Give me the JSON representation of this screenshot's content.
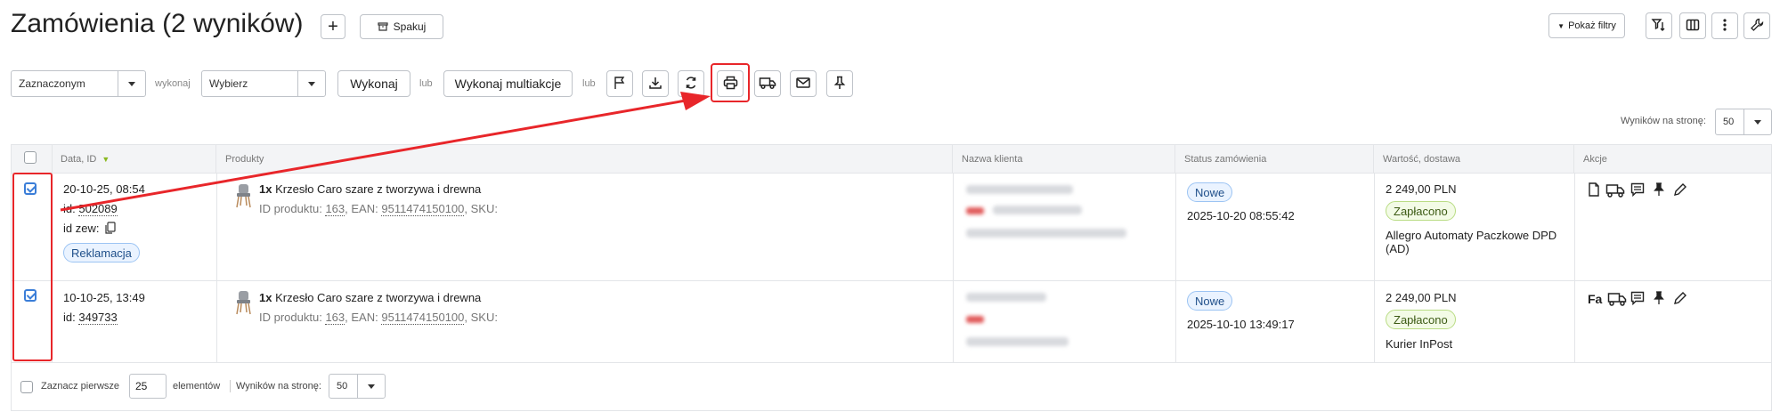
{
  "header": {
    "title": "Zamówienia (2 wyników)",
    "add_label": "+",
    "pack_label": "Spakuj",
    "show_filters_label": "Pokaż filtry"
  },
  "toolbar": {
    "scope_select": "Zaznaczonym",
    "wykonaj_label": "wykonaj",
    "action_select": "Wybierz",
    "execute_label": "Wykonaj",
    "lub1": "lub",
    "multiaction_label": "Wykonaj multiakcje",
    "lub2": "lub"
  },
  "per_page_top": {
    "label": "Wyników na stronę:",
    "value": "50"
  },
  "table": {
    "headers": [
      "Data, ID",
      "Produkty",
      "Nazwa klienta",
      "Status zamówienia",
      "Wartość, dostawa",
      "Akcje"
    ],
    "rows": [
      {
        "date": "20-10-25, 08:54",
        "id_label": "id:",
        "id": "502089",
        "ext_id_label": "id zew:",
        "tag": "Reklamacja",
        "qty": "1x",
        "product": "Krzesło Caro szare z tworzywa i drewna",
        "prod_id_label": "ID produktu:",
        "prod_id": "163",
        "ean_label": ", EAN:",
        "ean": "9511474150100",
        "sku_label": ", SKU:",
        "status": "Nowe",
        "status_date": "2025-10-20 08:55:42",
        "value": "2 249,00 PLN",
        "payment": "Zapłacono",
        "delivery": "Allegro Automaty Paczkowe DPD (AD)"
      },
      {
        "date": "10-10-25, 13:49",
        "id_label": "id:",
        "id": "349733",
        "qty": "1x",
        "product": "Krzesło Caro szare z tworzywa i drewna",
        "prod_id_label": "ID produktu:",
        "prod_id": "163",
        "ean_label": ", EAN:",
        "ean": "9511474150100",
        "sku_label": ", SKU:",
        "status": "Nowe",
        "status_date": "2025-10-10 13:49:17",
        "value": "2 249,00 PLN",
        "payment": "Zapłacono",
        "delivery": "Kurier InPost",
        "invoice_label": "Fa"
      }
    ]
  },
  "footer": {
    "select_first_label": "Zaznacz pierwsze",
    "select_first_value": "25",
    "elements_label": "elementów",
    "per_page_label": "Wyników na stronę:",
    "per_page_value": "50"
  },
  "colors": {
    "highlight_red": "#e8262a",
    "checkbox_blue": "#3b7ed8"
  }
}
